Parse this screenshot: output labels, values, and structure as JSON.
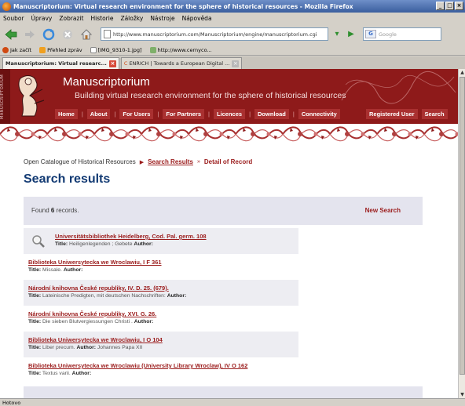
{
  "window": {
    "title": "Manuscriptorium: Virtual research environment for the sphere of historical resources - Mozilla Firefox",
    "controls": [
      "_",
      "□",
      "×"
    ]
  },
  "menu": [
    "Soubor",
    "Úpravy",
    "Zobrazit",
    "Historie",
    "Záložky",
    "Nástroje",
    "Nápověda"
  ],
  "nav": {
    "url": "http://www.manuscriptorium.com/Manuscriptorium/engine/manuscriptorium.cgi",
    "search_placeholder": "Google",
    "search_engine_icon": "G"
  },
  "bookmarks": [
    {
      "label": "Jak začít",
      "icon": "firefox-icon",
      "color": "#d04a12"
    },
    {
      "label": "Přehled zpráv",
      "icon": "rss-icon",
      "color": "#f0a020"
    },
    {
      "label": "[IMG_9310-1.jpg]",
      "icon": "page-icon",
      "color": "#ffffff"
    },
    {
      "label": "http://www.cernyco...",
      "icon": "page-icon",
      "color": "#7fb06a"
    }
  ],
  "tabs": [
    {
      "label": "Manuscriptorium: Virtual researc...",
      "active": true
    },
    {
      "label": "ENRICH | Towards a European Digital ...",
      "active": false
    }
  ],
  "site": {
    "side_label": "MANUSCRIPTORIUM",
    "title": "Manuscriptorium",
    "subtitle": "Building virtual research environment for the sphere of historical resources",
    "menu": [
      "Home",
      "About",
      "For Users",
      "For Partners",
      "Licences",
      "Download",
      "Connectivity"
    ],
    "menu_right": [
      "Registered User",
      "Search"
    ],
    "accent_color": "#8e1a1a"
  },
  "breadcrumb": {
    "root": "Open Catalogue of Historical Resources",
    "current": "Search Results",
    "next": "Detail of Record"
  },
  "page_title": "Search results",
  "result_bar": {
    "found_prefix": "Found",
    "found_count": "6",
    "found_suffix": "records.",
    "new_search": "New Search"
  },
  "records": [
    {
      "title": "Universitätsbibliothek Heidelberg, Cod. Pal. germ. 108",
      "title_label": "Title:",
      "title_value": "Heiligenlegenden ; Gebete",
      "author_label": "Author:",
      "author_value": ""
    },
    {
      "title": "Biblioteka Uniwersytecka we Wroclawiu, I F 361",
      "title_label": "Title:",
      "title_value": "Missale.",
      "author_label": "Author:",
      "author_value": ""
    },
    {
      "title": "Národní knihovna České republiky, IV. D. 25. (679).",
      "title_label": "Title:",
      "title_value": "Lateinische Predigten, mit deutschen Nachschriften:",
      "author_label": "Author:",
      "author_value": ""
    },
    {
      "title": "Národní knihovna České republiky, XVI. G. 26.",
      "title_label": "Title:",
      "title_value": "Die sieben Blutvergiessungen Christi .",
      "author_label": "Author:",
      "author_value": ""
    },
    {
      "title": "Biblioteka Uniwersytecka we Wroclawiu, I O 104",
      "title_label": "Title:",
      "title_value": "Liber precum.",
      "author_label": "Author:",
      "author_value": "Johannes Papa XII"
    },
    {
      "title": "Biblioteka Uniwersytecka we Wroclawiu (University Library Wroclaw), IV O 162",
      "title_label": "Title:",
      "title_value": "Textus varii.",
      "author_label": "Author:",
      "author_value": ""
    }
  ],
  "status": "Hotovo"
}
